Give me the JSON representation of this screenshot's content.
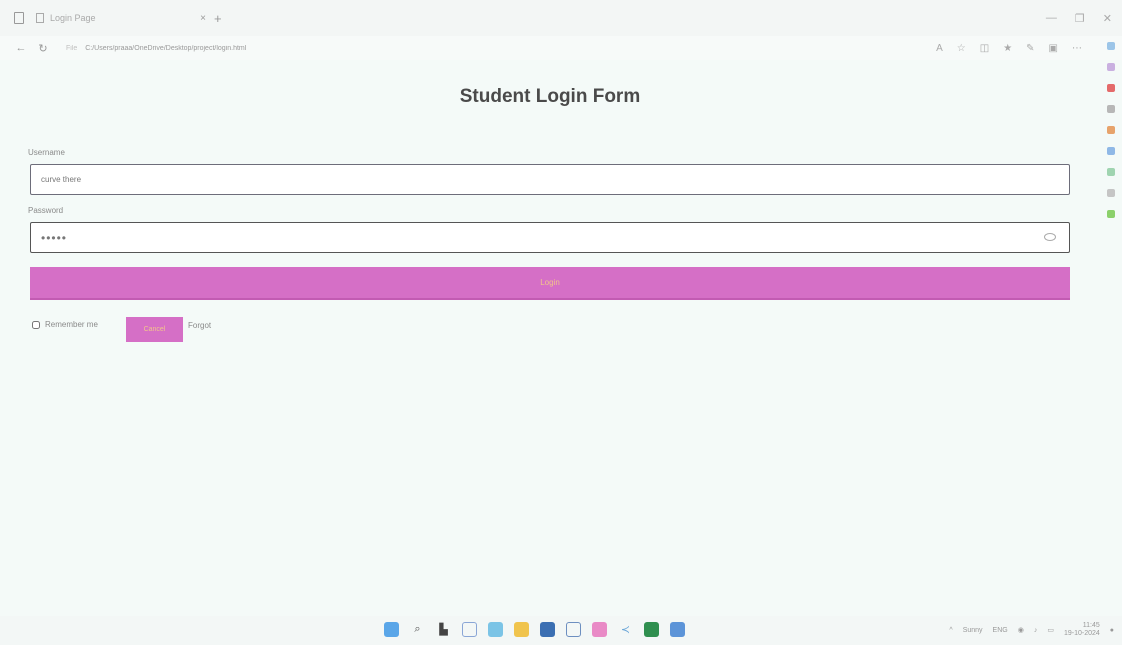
{
  "browser": {
    "tab_title": "Login Page",
    "url_scheme": "File",
    "url": "C:/Users/praaa/OneDrive/Desktop/project/login.html"
  },
  "page": {
    "title": "Student Login Form",
    "username_label": "Username",
    "username_value": "curve there",
    "password_label": "Password",
    "password_value": "•••••",
    "login_label": "Login",
    "remember_label": "Remember me",
    "cancel_label": "Cancel",
    "forgot_label": "Forgot"
  },
  "taskbar": {
    "weather_text": "Sunny",
    "language": "ENG",
    "time": "11:45",
    "date": "19-10-2024"
  },
  "colors": {
    "accent": "#d56fc6",
    "button_text": "#f2c48b",
    "background": "#f4faf8"
  },
  "icons": {
    "sidebar": [
      "search-icon",
      "copilot-icon",
      "shopping-icon",
      "tools-icon",
      "office-icon",
      "outlook-icon",
      "games-icon",
      "drop-icon",
      "add-icon"
    ],
    "taskbar": [
      "windows-icon",
      "search-icon",
      "widgets-icon",
      "chat-icon",
      "edge-icon",
      "folder-icon",
      "store-icon",
      "photos-icon",
      "paint-icon",
      "share-icon",
      "excel-icon",
      "mail-icon"
    ]
  }
}
